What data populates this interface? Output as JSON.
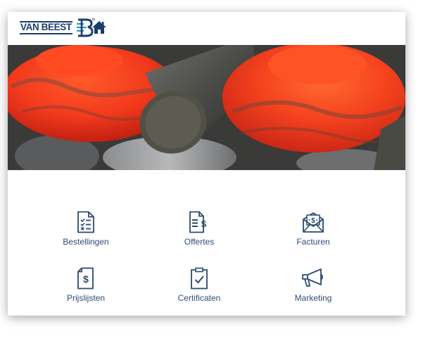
{
  "header": {
    "logo_text": "VAN BEEST",
    "home_icon": "home-icon",
    "brand_color": "#1b3d6d"
  },
  "hero": {
    "description_icon": "hero-image"
  },
  "tiles": [
    {
      "label": "Bestellingen",
      "icon": "order-checklist-icon"
    },
    {
      "label": "Offertes",
      "icon": "quote-document-icon"
    },
    {
      "label": "Facturen",
      "icon": "invoice-envelope-icon"
    },
    {
      "label": "Prijslijsten",
      "icon": "pricelist-icon"
    },
    {
      "label": "Certificaten",
      "icon": "certificate-clipboard-icon"
    },
    {
      "label": "Marketing",
      "icon": "megaphone-icon"
    }
  ],
  "colors": {
    "icon": "#2a4a70",
    "label": "#2d4d74"
  }
}
